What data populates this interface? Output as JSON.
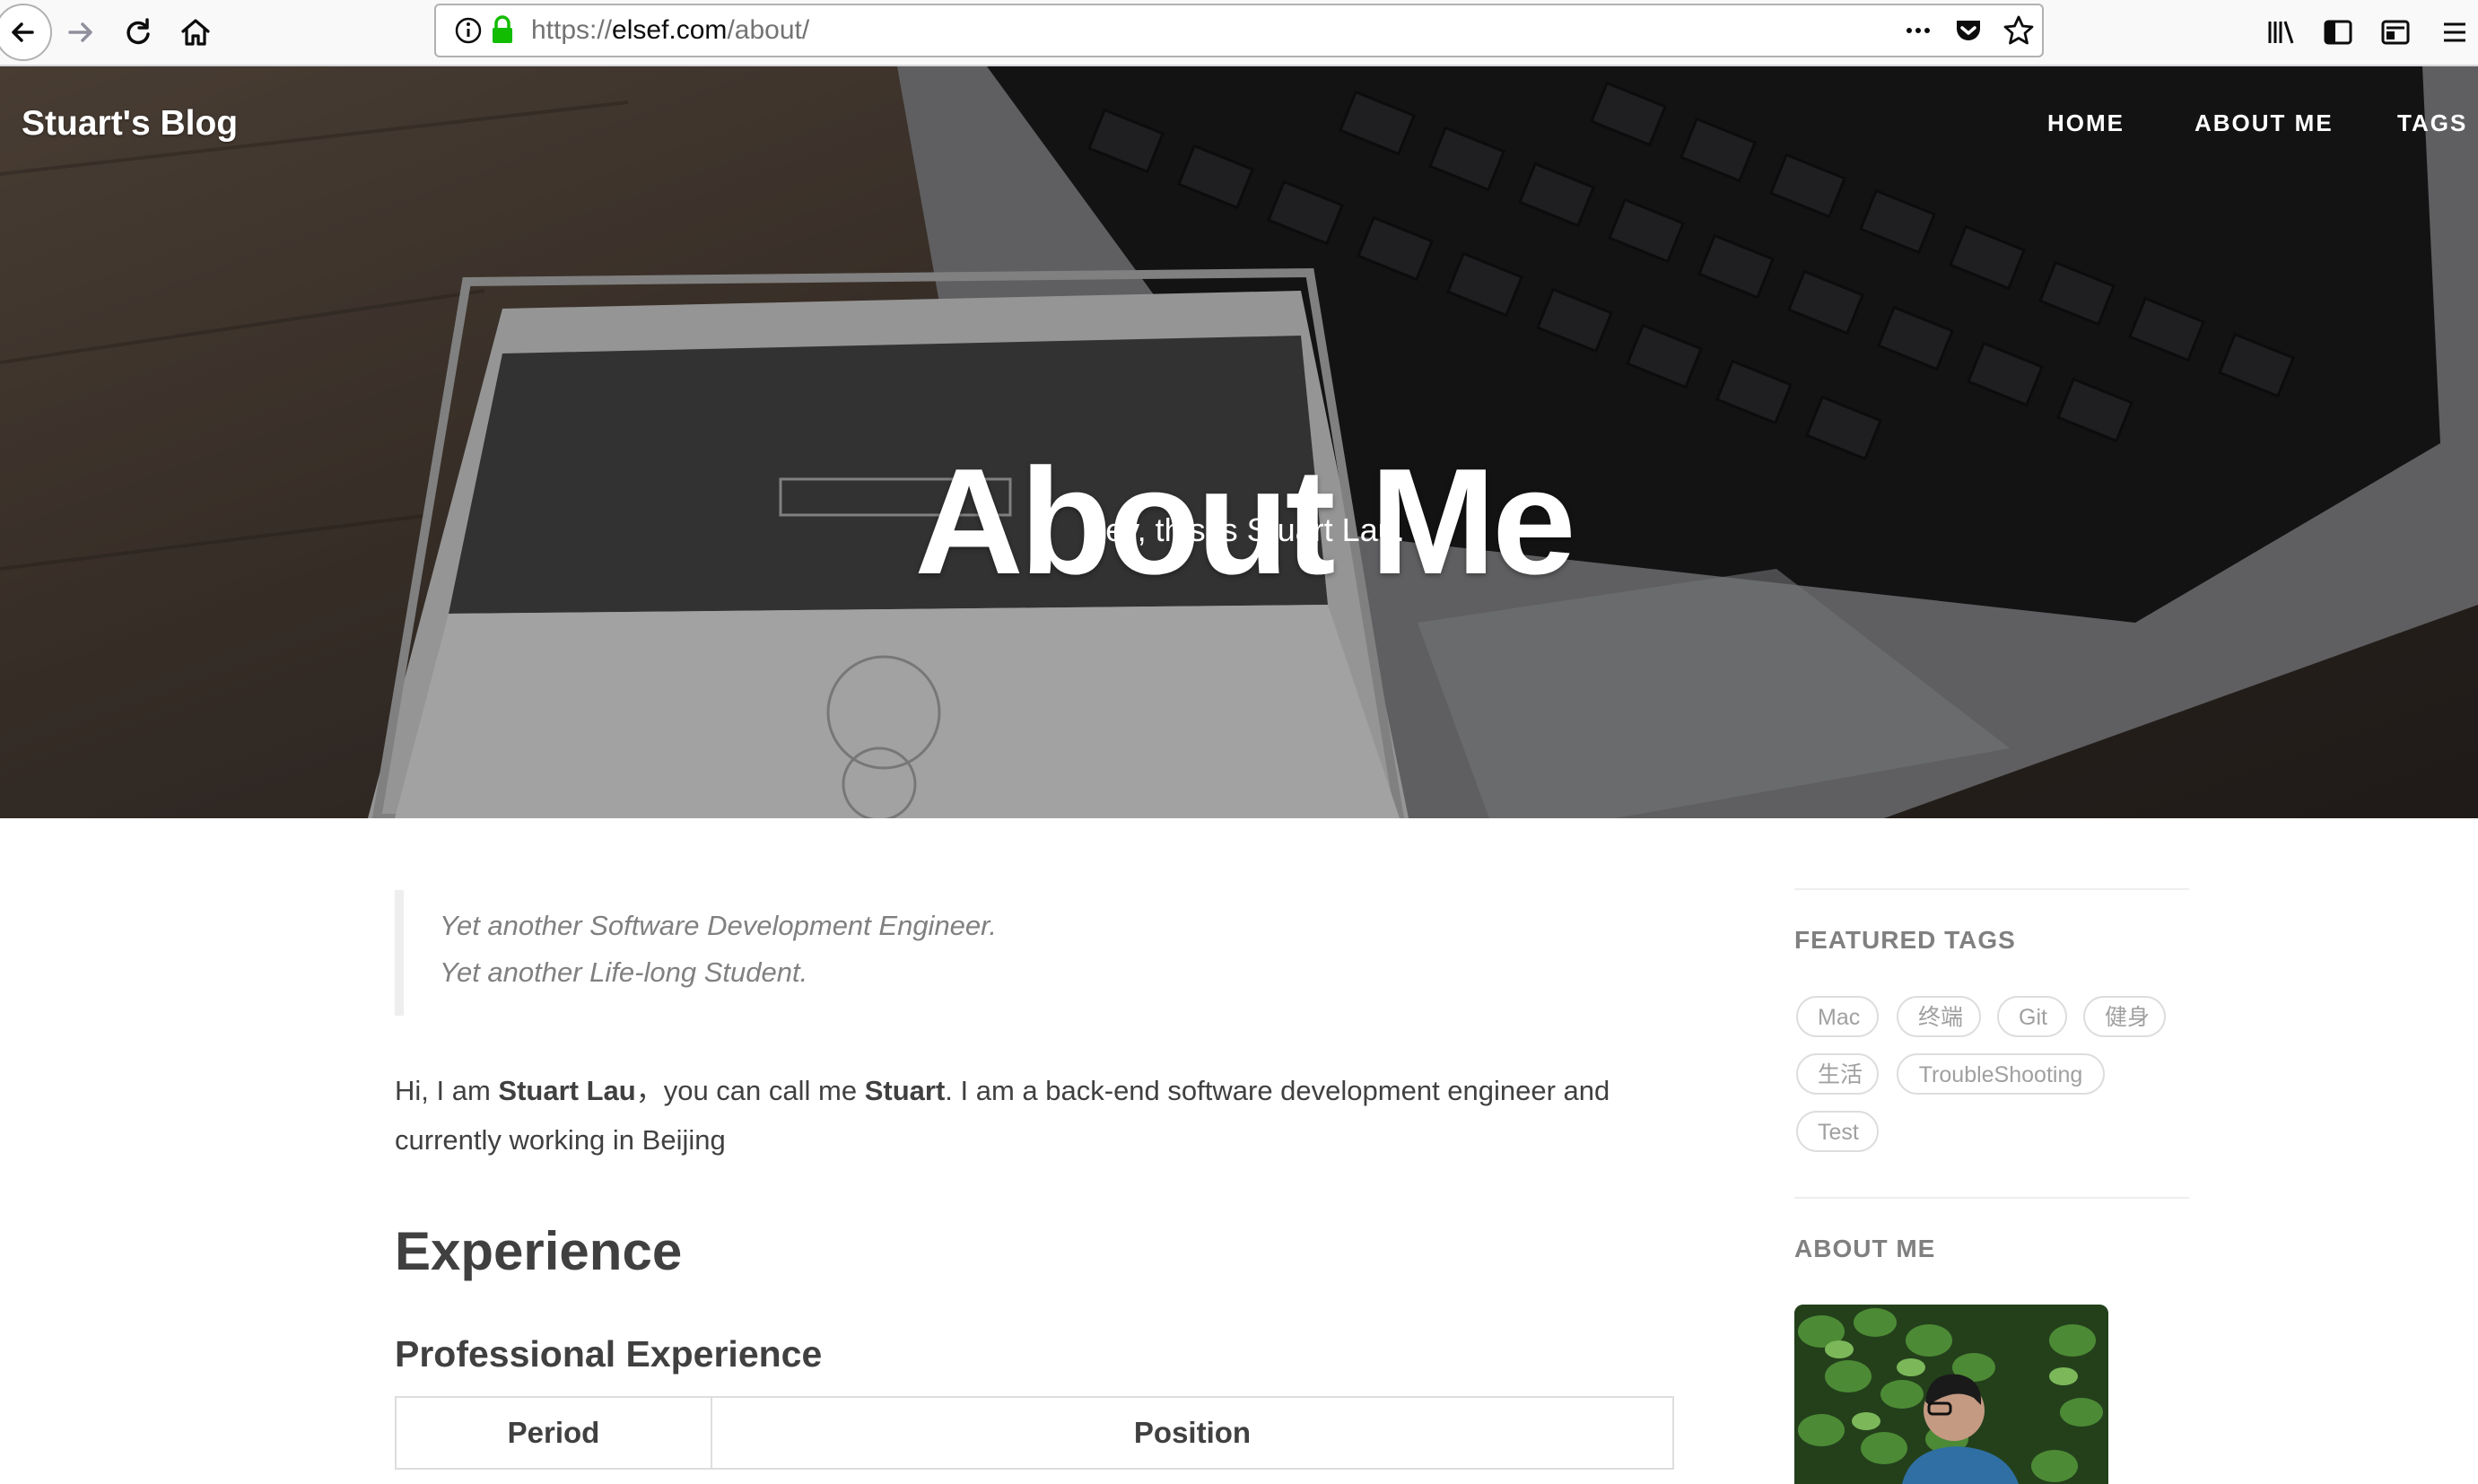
{
  "browser": {
    "url_scheme": "https://",
    "url_host": "elsef.com",
    "url_path": "/about/",
    "icons": [
      "back-icon",
      "forward-icon",
      "reload-icon",
      "home-icon",
      "info-icon",
      "lock-icon",
      "more-icon",
      "pocket-icon",
      "bookmark-star-icon",
      "library-icon",
      "sidebar-icon",
      "reader-icon",
      "menu-icon"
    ],
    "lock_color": "#12bc00"
  },
  "site": {
    "title": "Stuart's Blog",
    "nav": [
      "HOME",
      "ABOUT ME",
      "TAGS"
    ]
  },
  "hero": {
    "heading": "About Me",
    "subheading": "Hey, this is Stuart Lau."
  },
  "main": {
    "quote": [
      "Yet another Software Development Engineer.",
      "Yet another Life-long Student."
    ],
    "intro": {
      "part1": "Hi, I am ",
      "name_full": "Stuart Lau",
      "part2": "，you can call me ",
      "name_short": "Stuart",
      "part3": ". I am a back-end software development engineer and currently working in Beijing"
    },
    "experience_heading": "Experience",
    "professional_heading": "Professional Experience",
    "table_headers": [
      "Period",
      "Position"
    ]
  },
  "sidebar": {
    "featured_tags_heading": "FEATURED TAGS",
    "tags": [
      "Mac",
      "终端",
      "Git",
      "健身",
      "生活",
      "TroubleShooting",
      "Test"
    ],
    "about_me_heading": "ABOUT ME"
  }
}
